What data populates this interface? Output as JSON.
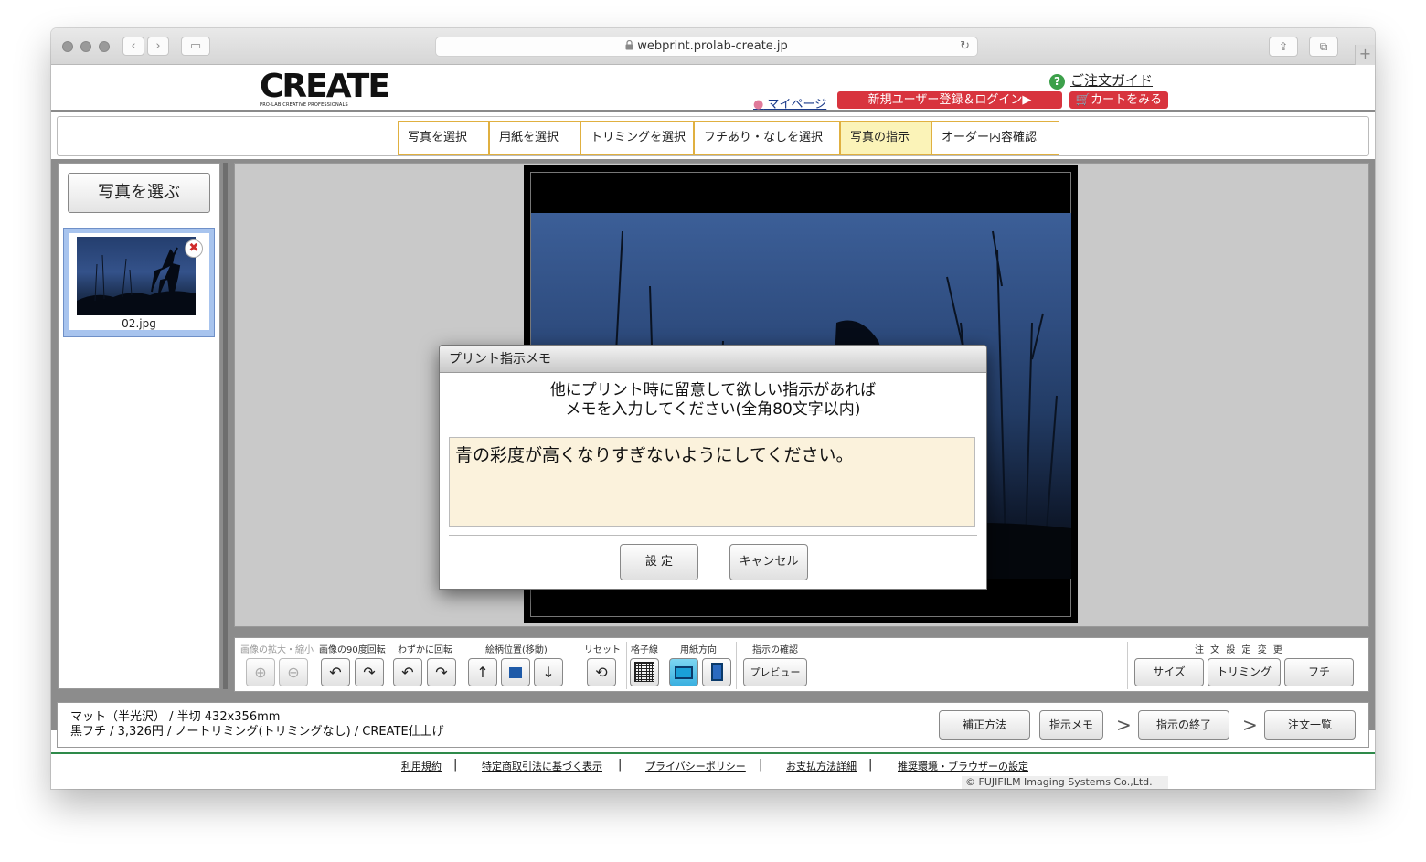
{
  "browser": {
    "url": "webprint.prolab-create.jp",
    "lock_icon": "lock-icon",
    "new_tab": "+"
  },
  "header": {
    "logo_text": "CREATE",
    "logo_sub": "PRO-LAB CREATIVE PROFESSIONALS",
    "guide_label": "ご注文ガイド",
    "mypage_label": "マイページ",
    "register_label": "新規ユーザー登録＆ログイン▶",
    "cart_label": "カートをみる",
    "accent_color": "#d8343e"
  },
  "steps": [
    {
      "label": "写真を選択",
      "active": false
    },
    {
      "label": "用紙を選択",
      "active": false
    },
    {
      "label": "トリミングを選択",
      "active": false
    },
    {
      "label": "フチあり・なしを選択",
      "active": false
    },
    {
      "label": "写真の指示",
      "active": true
    },
    {
      "label": "オーダー内容確認",
      "active": false
    }
  ],
  "left_panel": {
    "choose_label": "写真を選ぶ",
    "thumbnail": {
      "filename": "02.jpg"
    }
  },
  "toolbar": {
    "zoom_label": "画像の拡大・縮小",
    "rotate90_label": "画像の90度回転",
    "slight_rotate_label": "わずかに回転",
    "position_label": "絵柄位置(移動)",
    "reset_label": "リセット",
    "grid_label": "格子線",
    "orientation_label": "用紙方向",
    "confirm_label": "指示の確認",
    "preview_label": "プレビュー",
    "order_settings_label": "注 文 設 定 変 更",
    "size_label": "サイズ",
    "trimming_label": "トリミング",
    "border_label": "フチ"
  },
  "info": {
    "line1": "マット（半光沢） / 半切 432x356mm",
    "line2": "黒フチ / 3,326円 / ノートリミング(トリミングなし) / CREATE仕上げ",
    "correction_label": "補正方法",
    "memo_label": "指示メモ",
    "finish_label": "指示の終了",
    "order_list_label": "注文一覧",
    "arrow": ">"
  },
  "footer": {
    "links": [
      "利用規約",
      "特定商取引法に基づく表示",
      "プライバシーポリシー",
      "お支払方法詳細",
      "推奨環境・ブラウザーの設定"
    ],
    "separator": "|",
    "copyright": "© FUJIFILM Imaging Systems Co.,Ltd."
  },
  "dialog": {
    "title": "プリント指示メモ",
    "message_line1": "他にプリント時に留意して欲しい指示があれば",
    "message_line2": "メモを入力してください(全角80文字以内)",
    "memo_value": "青の彩度が高くなりすぎないようにしてください。",
    "ok_label": "設 定",
    "cancel_label": "キャンセル"
  }
}
